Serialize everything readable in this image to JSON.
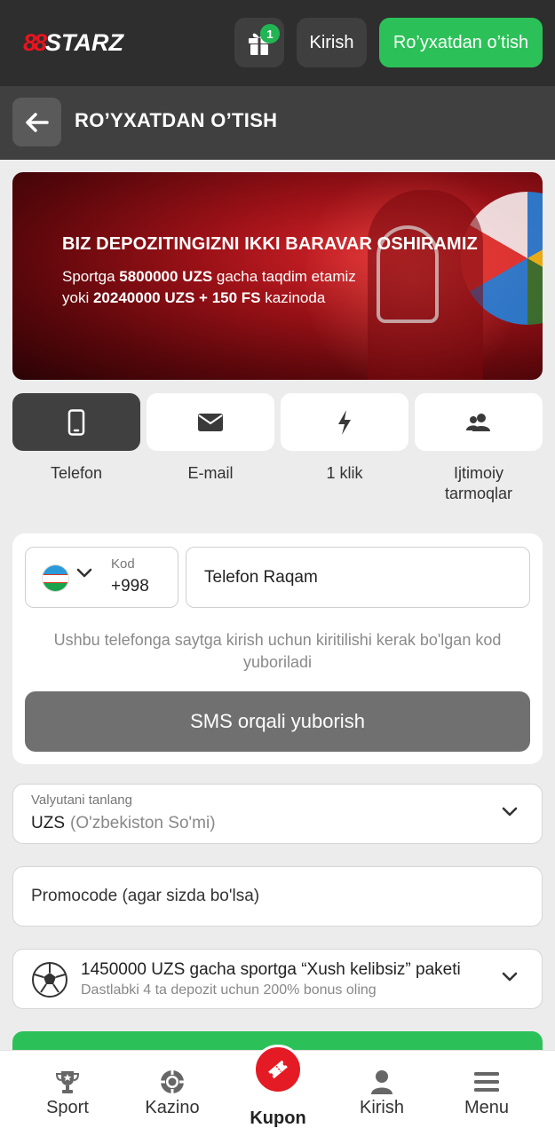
{
  "header": {
    "logo_prefix": "88",
    "logo_text": "STARZ",
    "gift_badge_count": "1",
    "login_label": "Kirish",
    "register_label": "Ro’yxatdan o’tish"
  },
  "titlebar": {
    "title": "RO’YXATDAN O’TISH"
  },
  "banner": {
    "headline": "BIZ DEPOZITINGIZNI IKKI BARAVAR OSHIRAMIZ",
    "line1_pre": "Sportga ",
    "line1_bold": "5800000 UZS",
    "line1_post": " gacha taqdim etamiz",
    "line2_pre": "yoki ",
    "line2_bold": "20240000 UZS + 150 FS",
    "line2_post": " kazinoda"
  },
  "methods": [
    {
      "label": "Telefon",
      "icon": "phone-icon",
      "active": true
    },
    {
      "label": "E-mail",
      "icon": "envelope-icon",
      "active": false
    },
    {
      "label": "1 klik",
      "icon": "lightning-icon",
      "active": false
    },
    {
      "label": "Ijtimoiy tarmoqlar",
      "icon": "users-icon",
      "active": false
    }
  ],
  "phone_form": {
    "code_label": "Kod",
    "code_value": "+998",
    "phone_placeholder": "Telefon Raqam",
    "hint": "Ushbu telefonga saytga kirish uchun kiritilishi kerak bo'lgan kod yuboriladi",
    "sms_button": "SMS orqali yuborish"
  },
  "currency": {
    "label": "Valyutani tanlang",
    "code": "UZS",
    "name": "(O'zbekiston So'mi)"
  },
  "promo": {
    "placeholder": "Promocode (agar sizda bo'lsa)"
  },
  "bonus": {
    "title": "1450000 UZS gacha sportga “Xush kelibsiz” paketi",
    "subtitle": "Dastlabki 4 ta depozit uchun 200% bonus oling"
  },
  "bottom_nav": {
    "sport": "Sport",
    "kazino": "Kazino",
    "kupon": "Kupon",
    "kirish": "Kirish",
    "menu": "Menu"
  },
  "colors": {
    "brand_red": "#e41b24",
    "accent_green": "#2cc158",
    "header_dark": "#2e2e2e"
  }
}
